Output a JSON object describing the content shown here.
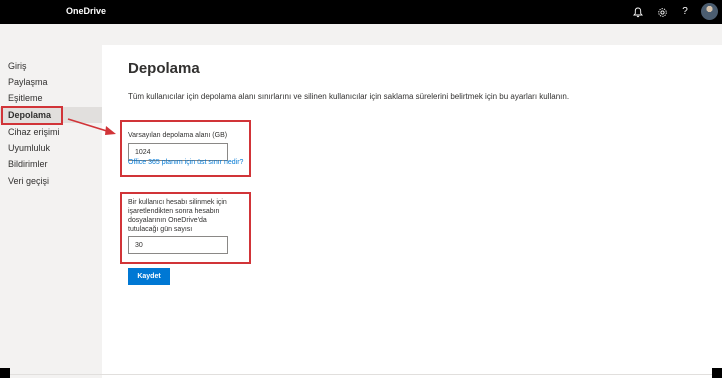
{
  "header": {
    "app_title": "OneDrive",
    "icons": [
      "bell-icon",
      "gear-icon",
      "help-icon",
      "avatar"
    ],
    "help_symbol": "?"
  },
  "sidebar": {
    "items": [
      {
        "label": "Giriş"
      },
      {
        "label": "Paylaşma"
      },
      {
        "label": "Eşitleme"
      },
      {
        "label": "Depolama",
        "active": true
      },
      {
        "label": "Cihaz erişimi"
      },
      {
        "label": "Uyumluluk"
      },
      {
        "label": "Bildirimler"
      },
      {
        "label": "Veri geçişi"
      }
    ]
  },
  "main": {
    "title": "Depolama",
    "intro": "Tüm kullanıcılar için depolama alanı sınırlarını ve silinen kullanıcılar için saklama sürelerini belirtmek için bu ayarları kullanın.",
    "storage": {
      "label": "Varsayılan depolama alanı (GB)",
      "value": "1024",
      "link": "Office 365 planım için üst sınır nedir?"
    },
    "retention": {
      "label_lines": [
        "Bir kullanıcı hesabı silinmek için",
        "işaretlendikten sonra hesabın",
        "dosyalarının OneDrive'da",
        "tutulacağı gün sayısı"
      ],
      "value": "30"
    },
    "save_label": "Kaydet"
  },
  "colors": {
    "accent": "#0078d4",
    "highlight_box": "#d13438",
    "topbar": "#000000"
  }
}
